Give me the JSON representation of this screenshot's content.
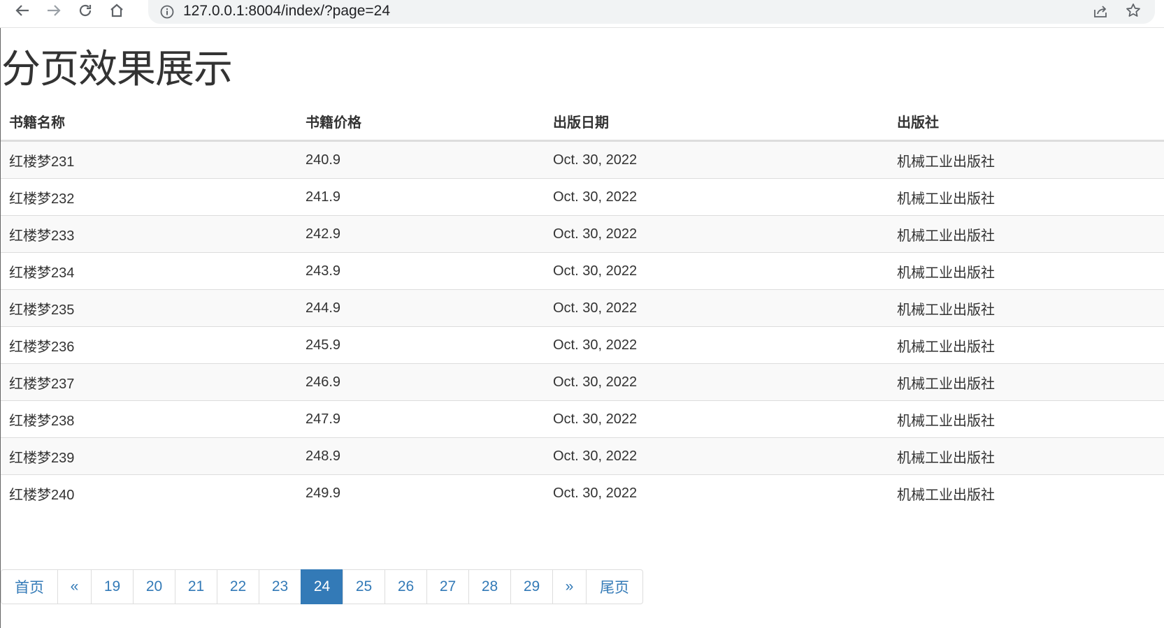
{
  "browser": {
    "url": "127.0.0.1:8004/index/?page=24",
    "icons": [
      "back-arrow-icon",
      "forward-arrow-icon",
      "reload-icon",
      "home-icon",
      "info-icon",
      "share-icon",
      "star-icon"
    ]
  },
  "page": {
    "title": "分页效果展示"
  },
  "table": {
    "headers": {
      "name": "书籍名称",
      "price": "书籍价格",
      "date": "出版日期",
      "publisher": "出版社"
    },
    "rows": [
      {
        "name": "红楼梦231",
        "price": "240.9",
        "date": "Oct. 30, 2022",
        "publisher": "机械工业出版社"
      },
      {
        "name": "红楼梦232",
        "price": "241.9",
        "date": "Oct. 30, 2022",
        "publisher": "机械工业出版社"
      },
      {
        "name": "红楼梦233",
        "price": "242.9",
        "date": "Oct. 30, 2022",
        "publisher": "机械工业出版社"
      },
      {
        "name": "红楼梦234",
        "price": "243.9",
        "date": "Oct. 30, 2022",
        "publisher": "机械工业出版社"
      },
      {
        "name": "红楼梦235",
        "price": "244.9",
        "date": "Oct. 30, 2022",
        "publisher": "机械工业出版社"
      },
      {
        "name": "红楼梦236",
        "price": "245.9",
        "date": "Oct. 30, 2022",
        "publisher": "机械工业出版社"
      },
      {
        "name": "红楼梦237",
        "price": "246.9",
        "date": "Oct. 30, 2022",
        "publisher": "机械工业出版社"
      },
      {
        "name": "红楼梦238",
        "price": "247.9",
        "date": "Oct. 30, 2022",
        "publisher": "机械工业出版社"
      },
      {
        "name": "红楼梦239",
        "price": "248.9",
        "date": "Oct. 30, 2022",
        "publisher": "机械工业出版社"
      },
      {
        "name": "红楼梦240",
        "price": "249.9",
        "date": "Oct. 30, 2022",
        "publisher": "机械工业出版社"
      }
    ]
  },
  "pagination": {
    "items": [
      {
        "label": "首页",
        "name": "first-page-link",
        "active": false
      },
      {
        "label": "«",
        "name": "previous-page-link",
        "active": false
      },
      {
        "label": "19",
        "name": "page-link-19",
        "active": false
      },
      {
        "label": "20",
        "name": "page-link-20",
        "active": false
      },
      {
        "label": "21",
        "name": "page-link-21",
        "active": false
      },
      {
        "label": "22",
        "name": "page-link-22",
        "active": false
      },
      {
        "label": "23",
        "name": "page-link-23",
        "active": false
      },
      {
        "label": "24",
        "name": "page-link-24",
        "active": true
      },
      {
        "label": "25",
        "name": "page-link-25",
        "active": false
      },
      {
        "label": "26",
        "name": "page-link-26",
        "active": false
      },
      {
        "label": "27",
        "name": "page-link-27",
        "active": false
      },
      {
        "label": "28",
        "name": "page-link-28",
        "active": false
      },
      {
        "label": "29",
        "name": "page-link-29",
        "active": false
      },
      {
        "label": "»",
        "name": "next-page-link",
        "active": false
      },
      {
        "label": "尾页",
        "name": "last-page-link",
        "active": false
      }
    ],
    "colors": {
      "link": "#337ab7",
      "active_bg": "#337ab7",
      "active_text": "#ffffff"
    }
  }
}
